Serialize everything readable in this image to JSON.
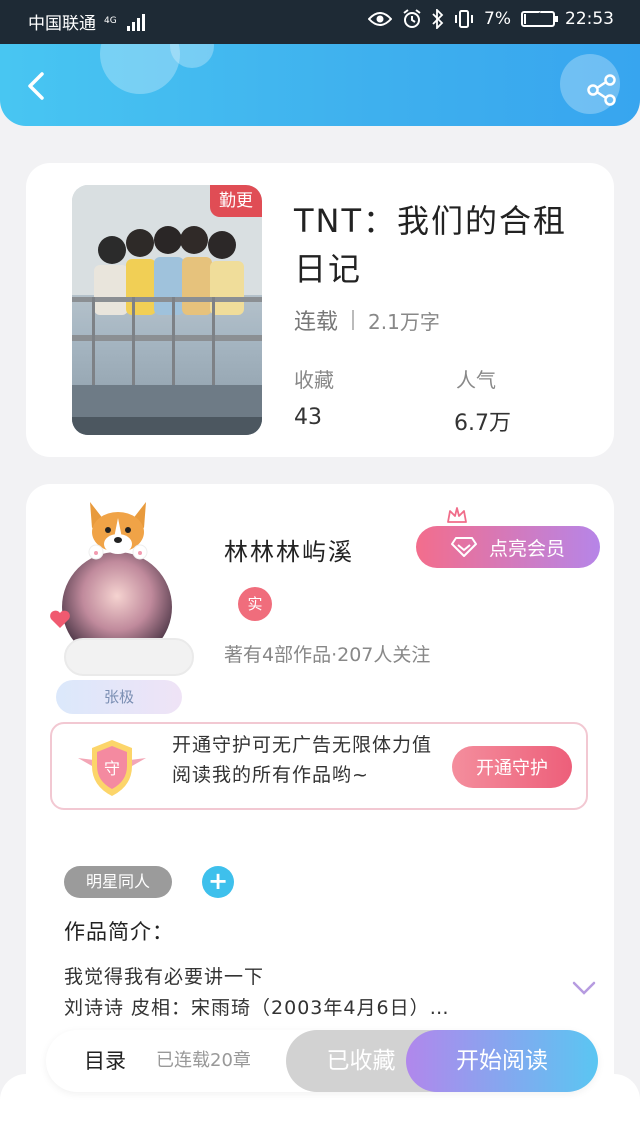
{
  "status_bar": {
    "carrier": "中国联通",
    "network": "4G",
    "battery_percent": "7%",
    "battery_level": 0.07,
    "time": "22:53"
  },
  "header": {
    "back_icon": "chevron-left-icon",
    "share_icon": "share-icon"
  },
  "book": {
    "badge": "勤更",
    "title": "TNT：我们的合租日记",
    "status": "连载",
    "word_count": "2.1万字",
    "stats": [
      {
        "label": "收藏",
        "value": "43"
      },
      {
        "label": "人气",
        "value": "6.7万"
      }
    ]
  },
  "author": {
    "name": "林林林屿溪",
    "badge_title": "张极",
    "verified": "实",
    "meta": "著有4部作品·207人关注",
    "vip_button": "点亮会员"
  },
  "guard": {
    "icon_text": "守",
    "text": "开通守护可无广告无限体力值阅读我的所有作品哟~",
    "button": "开通守护"
  },
  "tags": [
    "明星同人"
  ],
  "intro": {
    "label": "作品简介：",
    "line1": "我觉得我有必要讲一下",
    "line2": "刘诗诗 皮相：宋雨琦（2003年4月6日）…"
  },
  "bottom_bar": {
    "toc": "目录",
    "chapters": "已连载20章",
    "collected": "已收藏",
    "read": "开始阅读"
  },
  "colors": {
    "header": "#3fb1ee",
    "badge_red": "#e04d55",
    "accent_pink": "#ed5f7a",
    "accent_purple": "#b187ec",
    "accent_blue": "#3ec0ec"
  }
}
